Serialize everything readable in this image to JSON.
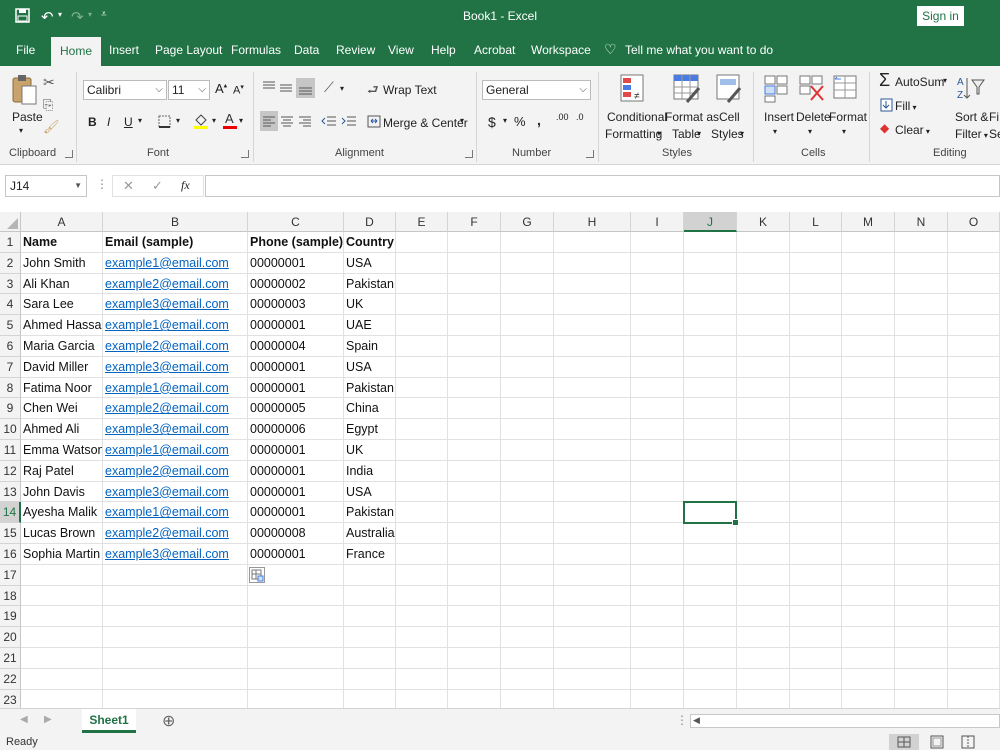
{
  "window": {
    "title": "Book1  -  Excel",
    "sign_in": "Sign in"
  },
  "tabs": [
    "File",
    "Home",
    "Insert",
    "Page Layout",
    "Formulas",
    "Data",
    "Review",
    "View",
    "Help",
    "Acrobat",
    "Workspace"
  ],
  "tell_me": "Tell me what you want to do",
  "ribbon": {
    "clipboard": {
      "label": "Clipboard",
      "paste": "Paste"
    },
    "font": {
      "label": "Font",
      "name": "Calibri",
      "size": "11",
      "grow": "A",
      "shrink": "A",
      "bold": "B",
      "italic": "I",
      "underline": "U"
    },
    "alignment": {
      "label": "Alignment",
      "wrap_text": "Wrap Text",
      "merge_center": "Merge & Center"
    },
    "number": {
      "label": "Number",
      "format": "General",
      "currency": "$",
      "percent": "%",
      "comma": ",",
      "inc_decimal": ".00",
      "dec_decimal": ".0"
    },
    "styles": {
      "label": "Styles",
      "conditional_1": "Conditional",
      "conditional_2": "Formatting",
      "format_as_1": "Format as",
      "format_as_2": "Table",
      "cell_styles_1": "Cell",
      "cell_styles_2": "Styles"
    },
    "cells": {
      "label": "Cells",
      "insert": "Insert",
      "delete": "Delete",
      "format": "Format"
    },
    "editing": {
      "label": "Editing",
      "autosum": "AutoSum",
      "fill": "Fill",
      "clear": "Clear",
      "sort_1": "Sort &",
      "sort_2": "Filter",
      "find": "Fi",
      "find_2": "Sel"
    }
  },
  "formula_bar": {
    "name_box": "J14",
    "formula": "",
    "fx": "fx"
  },
  "columns": [
    "A",
    "B",
    "C",
    "D",
    "E",
    "F",
    "G",
    "H",
    "I",
    "J",
    "K",
    "L",
    "M",
    "N",
    "O"
  ],
  "selected_cell": {
    "column": "J",
    "row": 14
  },
  "rows": [
    "1",
    "2",
    "3",
    "4",
    "5",
    "6",
    "7",
    "8",
    "9",
    "10",
    "11",
    "12",
    "13",
    "14",
    "15",
    "16",
    "17",
    "18",
    "19",
    "20",
    "21",
    "22",
    "23"
  ],
  "table": {
    "headers": [
      "Name",
      "Email (sample)",
      "Phone (sample)",
      "Country"
    ],
    "data": [
      [
        "John Smith",
        "example1@email.com",
        "00000001",
        "USA"
      ],
      [
        "Ali Khan",
        "example2@email.com",
        "00000002",
        "Pakistan"
      ],
      [
        "Sara Lee",
        "example3@email.com",
        "00000003",
        "UK"
      ],
      [
        "Ahmed Hassan",
        "example1@email.com",
        "00000001",
        "UAE"
      ],
      [
        "Maria Garcia",
        "example2@email.com",
        "00000004",
        "Spain"
      ],
      [
        "David Miller",
        "example3@email.com",
        "00000001",
        "USA"
      ],
      [
        "Fatima Noor",
        "example1@email.com",
        "00000001",
        "Pakistan"
      ],
      [
        "Chen Wei",
        "example2@email.com",
        "00000005",
        "China"
      ],
      [
        "Ahmed Ali",
        "example3@email.com",
        "00000006",
        "Egypt"
      ],
      [
        "Emma Watson",
        "example1@email.com",
        "00000001",
        "UK"
      ],
      [
        "Raj Patel",
        "example2@email.com",
        "00000001",
        "India"
      ],
      [
        "John Davis",
        "example3@email.com",
        "00000001",
        "USA"
      ],
      [
        "Ayesha Malik",
        "example1@email.com",
        "00000001",
        "Pakistan"
      ],
      [
        "Lucas Brown",
        "example2@email.com",
        "00000008",
        "Australia"
      ],
      [
        "Sophia Martin",
        "example3@email.com",
        "00000001",
        "France"
      ]
    ]
  },
  "sheets": [
    "Sheet1"
  ],
  "status": {
    "text": "Ready"
  },
  "colors": {
    "accent": "#217346",
    "link": "#0563c1"
  }
}
